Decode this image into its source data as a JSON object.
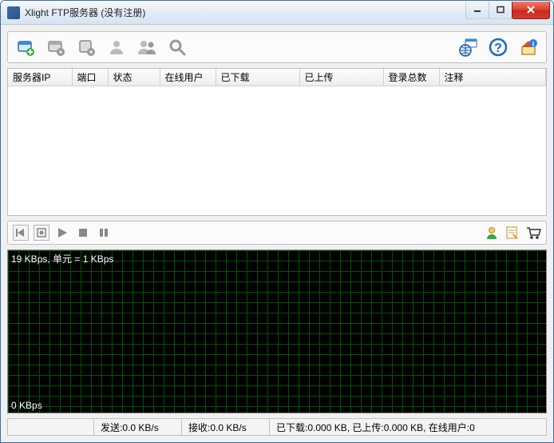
{
  "window": {
    "title": "Xlight FTP服务器 (没有注册)"
  },
  "toolbar_main": {
    "add_server": "add-server",
    "server_settings": "server-settings",
    "global_settings": "global-settings",
    "user": "user",
    "users": "users",
    "search": "search",
    "internet": "internet-status",
    "help": "help",
    "home": "home"
  },
  "server_list": {
    "columns": [
      "服务器IP",
      "端口",
      "状态",
      "在线用户",
      "已下载",
      "已上传",
      "登录总数",
      "注释"
    ],
    "rows": []
  },
  "toolbar_play": {
    "step_back": "step-back",
    "stop_record": "stop-record",
    "play": "play",
    "stop": "stop",
    "pause": "pause",
    "user_status": "user-status",
    "edit_log": "edit-log",
    "cart": "cart"
  },
  "graph": {
    "top_label": "19 KBps, 单元 = 1 KBps",
    "bottom_label": "0 KBps"
  },
  "status": {
    "send": "发送:0.0 KB/s",
    "recv": "接收:0.0 KB/s",
    "summary": "已下载:0.000 KB, 已上传:0.000 KB, 在线用户:0"
  }
}
